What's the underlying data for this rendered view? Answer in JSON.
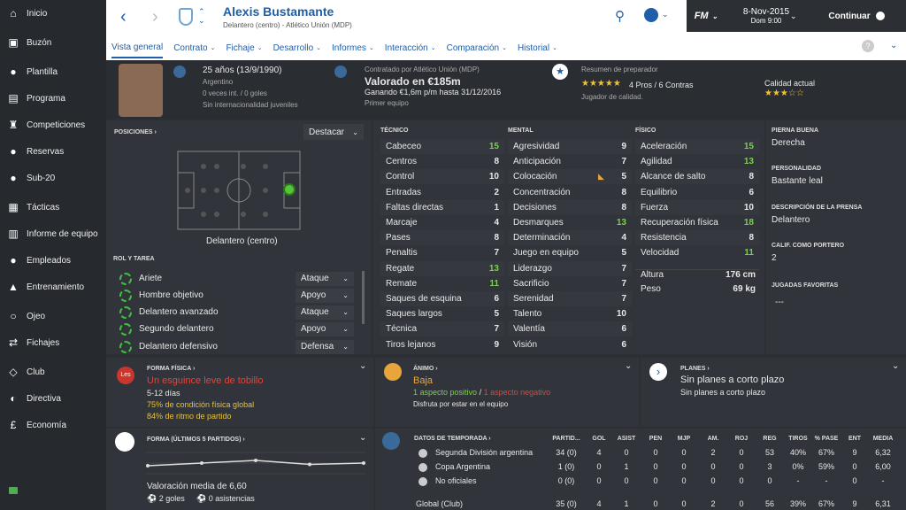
{
  "sidebar": {
    "items": [
      {
        "label": "Inicio",
        "icon": "home-icon"
      },
      {
        "label": "Buzón",
        "icon": "inbox-icon"
      },
      {
        "label": "Plantilla",
        "icon": "squad-icon"
      },
      {
        "label": "Programa",
        "icon": "calendar-icon"
      },
      {
        "label": "Competiciones",
        "icon": "trophy-icon"
      },
      {
        "label": "Reservas",
        "icon": "reserves-icon"
      },
      {
        "label": "Sub-20",
        "icon": "u20-icon"
      },
      {
        "label": "Tácticas",
        "icon": "tactics-icon"
      },
      {
        "label": "Informe de equipo",
        "icon": "report-icon"
      },
      {
        "label": "Empleados",
        "icon": "staff-icon"
      },
      {
        "label": "Entrenamiento",
        "icon": "training-icon"
      },
      {
        "label": "Ojeo",
        "icon": "scouting-icon"
      },
      {
        "label": "Fichajes",
        "icon": "transfers-icon"
      },
      {
        "label": "Club",
        "icon": "club-icon"
      },
      {
        "label": "Directiva",
        "icon": "board-icon"
      },
      {
        "label": "Economía",
        "icon": "finance-icon"
      }
    ]
  },
  "header": {
    "name": "Alexis Bustamante",
    "subtitle": "Delantero (centro) - Atlético Unión (MDP)",
    "date": "8-Nov-2015",
    "day_time": "Dom 9:00",
    "continue_label": "Continuar",
    "fm_label": "FM"
  },
  "tabs": [
    "Vista general",
    "Contrato",
    "Fichaje",
    "Desarrollo",
    "Informes",
    "Interacción",
    "Comparación",
    "Historial"
  ],
  "profile": {
    "age": "25 años (13/9/1990)",
    "nationality": "Argentino",
    "caps": "0 veces int. / 0 goles",
    "youth": "Sin internacionalidad juveniles",
    "contract_by": "Contratado por Atlético Unión (MDP)",
    "value": "Valorado en €185m",
    "wage": "Ganando €1,6m p/m hasta 31/12/2016",
    "team": "Primer equipo",
    "coach_title": "Resumen de preparador",
    "pros_cons": "4 Pros / 6 Contras",
    "coach_desc": "Jugador de calidad.",
    "current_ability": "Calidad actual",
    "potential_stars": 3.5,
    "current_stars": 3.5
  },
  "positions": {
    "title": "POSICIONES",
    "highlight_label": "Destacar",
    "position_label": "Delantero (centro)"
  },
  "roles": {
    "title": "ROL Y TAREA",
    "items": [
      {
        "role": "Ariete",
        "duty": "Ataque"
      },
      {
        "role": "Hombre objetivo",
        "duty": "Apoyo"
      },
      {
        "role": "Delantero avanzado",
        "duty": "Ataque"
      },
      {
        "role": "Segundo delantero",
        "duty": "Apoyo"
      },
      {
        "role": "Delantero defensivo",
        "duty": "Defensa"
      }
    ]
  },
  "attributes": {
    "technical_title": "TÉCNICO",
    "mental_title": "MENTAL",
    "physical_title": "FÍSICO",
    "technical": [
      {
        "name": "Cabeceo",
        "value": "15"
      },
      {
        "name": "Centros",
        "value": "8"
      },
      {
        "name": "Control",
        "value": "10"
      },
      {
        "name": "Entradas",
        "value": "2"
      },
      {
        "name": "Faltas directas",
        "value": "1"
      },
      {
        "name": "Marcaje",
        "value": "4"
      },
      {
        "name": "Pases",
        "value": "8"
      },
      {
        "name": "Penaltis",
        "value": "7"
      },
      {
        "name": "Regate",
        "value": "13"
      },
      {
        "name": "Remate",
        "value": "11"
      },
      {
        "name": "Saques de esquina",
        "value": "6"
      },
      {
        "name": "Saques largos",
        "value": "5"
      },
      {
        "name": "Técnica",
        "value": "7"
      },
      {
        "name": "Tiros lejanos",
        "value": "9"
      }
    ],
    "mental": [
      {
        "name": "Agresividad",
        "value": "9"
      },
      {
        "name": "Anticipación",
        "value": "7"
      },
      {
        "name": "Colocación",
        "value": "5"
      },
      {
        "name": "Concentración",
        "value": "8"
      },
      {
        "name": "Decisiones",
        "value": "8"
      },
      {
        "name": "Desmarques",
        "value": "13"
      },
      {
        "name": "Determinación",
        "value": "4"
      },
      {
        "name": "Juego en equipo",
        "value": "5"
      },
      {
        "name": "Liderazgo",
        "value": "7"
      },
      {
        "name": "Sacrificio",
        "value": "7"
      },
      {
        "name": "Serenidad",
        "value": "7"
      },
      {
        "name": "Talento",
        "value": "10"
      },
      {
        "name": "Valentía",
        "value": "6"
      },
      {
        "name": "Visión",
        "value": "6"
      }
    ],
    "physical": [
      {
        "name": "Aceleración",
        "value": "15"
      },
      {
        "name": "Agilidad",
        "value": "13"
      },
      {
        "name": "Alcance de salto",
        "value": "8"
      },
      {
        "name": "Equilibrio",
        "value": "6"
      },
      {
        "name": "Fuerza",
        "value": "10"
      },
      {
        "name": "Recuperación física",
        "value": "18"
      },
      {
        "name": "Resistencia",
        "value": "8"
      },
      {
        "name": "Velocidad",
        "value": "11"
      }
    ],
    "height_label": "Altura",
    "height": "176 cm",
    "weight_label": "Peso",
    "weight": "69 kg"
  },
  "info": {
    "foot_label": "PIERNA BUENA",
    "foot": "Derecha",
    "personality_label": "PERSONALIDAD",
    "personality": "Bastante leal",
    "media_label": "DESCRIPCIÓN DE LA PRENSA",
    "media": "Delantero",
    "gk_label": "CALIF. COMO PORTERO",
    "gk": "2",
    "plays_label": "JUGADAS FAVORITAS",
    "plays": "---"
  },
  "fitness": {
    "title": "FORMA FÍSICA",
    "badge": "Les",
    "injury": "Un esguince leve de tobillo",
    "days": "5-12 días",
    "condition": "75% de condición física global",
    "match": "84% de ritmo de partido"
  },
  "morale": {
    "title": "ÁNIMO",
    "value": "Baja",
    "positive": "1 aspecto positivo",
    "separator": "/",
    "negative": "1 aspecto negativo",
    "desc": "Disfruta por estar en el equipo"
  },
  "plans": {
    "title": "PLANES",
    "value": "Sin planes a corto plazo",
    "desc": "Sin planes a corto plazo"
  },
  "form": {
    "title": "FORMA (ÚLTIMOS 5 PARTIDOS)",
    "avg": "Valoración media de 6,60",
    "goals": "2 goles",
    "assists": "0 asistencias",
    "ratings": [
      6.5,
      6.6,
      6.7,
      6.55,
      6.6
    ]
  },
  "season": {
    "title": "DATOS DE TEMPORADA",
    "headers": [
      "PARTID...",
      "GOL",
      "ASIST",
      "PEN",
      "MJP",
      "AM.",
      "ROJ",
      "REG",
      "TIROS",
      "% PASE",
      "ENT",
      "MEDIA"
    ],
    "rows": [
      {
        "name": "Segunda División argentina",
        "cells": [
          "34 (0)",
          "4",
          "0",
          "0",
          "0",
          "2",
          "0",
          "53",
          "40%",
          "67%",
          "9",
          "6,32"
        ]
      },
      {
        "name": "Copa Argentina",
        "cells": [
          "1 (0)",
          "0",
          "1",
          "0",
          "0",
          "0",
          "0",
          "3",
          "0%",
          "59%",
          "0",
          "6,00"
        ]
      },
      {
        "name": "No oficiales",
        "cells": [
          "0 (0)",
          "0",
          "0",
          "0",
          "0",
          "0",
          "0",
          "0",
          "-",
          "-",
          "0",
          "-"
        ]
      }
    ],
    "total": {
      "name": "Global (Club)",
      "cells": [
        "35 (0)",
        "4",
        "1",
        "0",
        "0",
        "2",
        "0",
        "56",
        "39%",
        "67%",
        "9",
        "6,31"
      ]
    }
  },
  "colors": {
    "accent": "#1f5fa8",
    "green": "#7ad14a",
    "red": "#e0453a",
    "orange": "#e8a53a"
  }
}
